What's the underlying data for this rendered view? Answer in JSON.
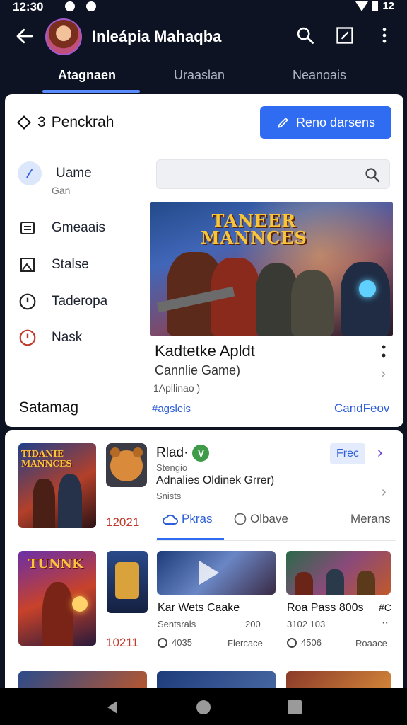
{
  "status_bar": {
    "time": "12:30",
    "right_text": "12"
  },
  "app_bar": {
    "title": "Inleápia Mahaqba",
    "avatar_name": "avatar",
    "actions": [
      "search-icon",
      "edit-icon",
      "more-icon"
    ]
  },
  "tabs": [
    {
      "label": "Atagnaen",
      "active": true
    },
    {
      "label": "Uraaslan",
      "active": false
    },
    {
      "label": "Neanoais",
      "active": false
    }
  ],
  "card1": {
    "title_num": "3",
    "title": "Penckrah",
    "button_label": "Reno darsens",
    "nav": [
      {
        "label": "Uame",
        "icon": "chevron-icon",
        "selected": true
      },
      {
        "label": "Gmeaais",
        "icon": "list-icon",
        "selected": false
      },
      {
        "label": "Stalse",
        "icon": "photo-icon",
        "selected": false
      },
      {
        "label": "Taderopa",
        "icon": "info-icon",
        "selected": false
      },
      {
        "label": "Nask",
        "icon": "alert-icon",
        "selected": false
      }
    ],
    "nav_sub": "Gan",
    "search": {
      "placeholder": ""
    },
    "hero": {
      "title_line1": "TANEER",
      "title_line2": "MANNCES"
    },
    "game_title": "Kadtetke Apldt",
    "game_sub": "Cannlie Game)",
    "game_meta": "1Apllinao )",
    "footer_left": "Satamag",
    "footer_mid": "#agsleis",
    "footer_right": "CandFeov"
  },
  "card2": {
    "row": {
      "title": "Rlad·",
      "badge": "V",
      "sub": "Stengio",
      "desc": "Adnalies Oldinek Grrer)",
      "meta": "Snists",
      "free_label": "Frec"
    },
    "thumb1_caption": "TIDANIE MANNCES",
    "thumb2_caption": "TUNNK",
    "price1": "12021",
    "segments": [
      {
        "label": "Pkras",
        "icon": "cloud-icon",
        "active": true
      },
      {
        "label": "Olbave",
        "icon": "refresh-icon",
        "active": false
      },
      {
        "label": "Merans",
        "icon": "",
        "active": false
      }
    ],
    "tiles": [
      {
        "title": "Kar Wets Caake",
        "meta_left": "Sentsrals",
        "meta_right": "200",
        "foot_left": "4035",
        "foot_right": "Flercace"
      },
      {
        "title": "Roa Pass 800s",
        "title_right": "#C",
        "meta_left": "3102 103",
        "meta_right": "",
        "foot_left": "4506",
        "foot_right": "Roaace"
      }
    ],
    "price2": "10211"
  },
  "colors": {
    "accent": "#2f6cf2",
    "bg_dark": "#0d1322",
    "price": "#c0392b"
  }
}
